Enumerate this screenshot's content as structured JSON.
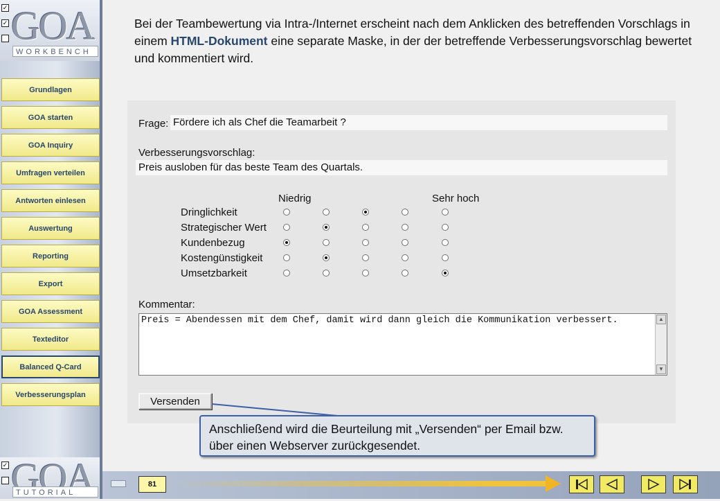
{
  "logo_top": {
    "letters": "GOA",
    "sub": "WORKBENCH"
  },
  "logo_bottom": {
    "letters": "GOA",
    "sub": "TUTORIAL"
  },
  "sidebar": {
    "items": [
      {
        "label": "Grundlagen"
      },
      {
        "label": "GOA starten"
      },
      {
        "label": "GOA Inquiry"
      },
      {
        "label": "Umfragen verteilen"
      },
      {
        "label": "Antworten einlesen"
      },
      {
        "label": "Auswertung"
      },
      {
        "label": "Reporting"
      },
      {
        "label": "Export"
      },
      {
        "label": "GOA Assessment"
      },
      {
        "label": "Texteditor"
      },
      {
        "label": "Balanced Q-Card",
        "active": true
      },
      {
        "label": "Verbesserungsplan"
      }
    ]
  },
  "intro": {
    "part1": "Bei der Teambewertung via Intra-/Internet erscheint nach dem Anklicken des betreffenden Vorschlags in einem ",
    "highlight": "HTML-Dokument",
    "part2": " eine separate Maske, in der der betreffende Verbesserungsvorschlag bewertet und kommentiert wird."
  },
  "form": {
    "question_label": "Frage:",
    "question_value": "Fördere ich als Chef die Teamarbeit ?",
    "proposal_label": "Verbesserungsvorschlag:",
    "proposal_value": "Preis ausloben für das beste Team des Quartals.",
    "scale_low": "Niedrig",
    "scale_high": "Sehr hoch",
    "criteria": [
      {
        "label": "Dringlichkeit",
        "selected": 3
      },
      {
        "label": "Strategischer Wert",
        "selected": 2
      },
      {
        "label": "Kundenbezug",
        "selected": 1
      },
      {
        "label": "Kostengünstigkeit",
        "selected": 2
      },
      {
        "label": "Umsetzbarkeit",
        "selected": 5
      }
    ],
    "comment_label": "Kommentar:",
    "comment_value": "Preis = Abendessen mit dem Chef, damit wird dann gleich die Kommunikation verbessert.",
    "send_label": "Versenden"
  },
  "callout": {
    "text": "Anschließend wird die Beurteilung mit „Versenden“ per Email bzw. über einen Webserver zurückgesendet."
  },
  "footer": {
    "page_number": "81"
  },
  "icons": {
    "first": "first-page-icon",
    "prev": "previous-page-icon",
    "next": "next-page-icon",
    "last": "last-page-icon"
  },
  "colors": {
    "nav_button": "#f6ef9e",
    "accent_text": "#27476e",
    "callout_border": "#3c5fa8",
    "arrow": "#f0b424"
  }
}
